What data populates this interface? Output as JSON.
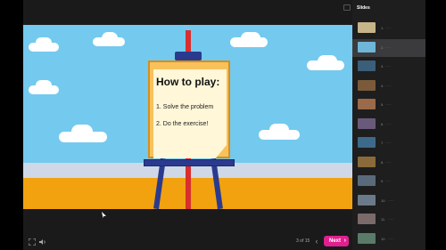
{
  "slide": {
    "title": "How to play:",
    "steps": [
      "1.  Solve the problem",
      "2.  Do the exercise!"
    ]
  },
  "controls": {
    "page_indicator": "3 of 15",
    "prev_label": "‹",
    "next_label": "Next",
    "next_chevron": "›"
  },
  "sidebar": {
    "header": "Slides",
    "active_index": 1,
    "items": [
      {
        "num": "1.",
        "text": "·····"
      },
      {
        "num": "2.",
        "text": "·····"
      },
      {
        "num": "3.",
        "text": "·····"
      },
      {
        "num": "4.",
        "text": "·····"
      },
      {
        "num": "5.",
        "text": "·····"
      },
      {
        "num": "6.",
        "text": "·····"
      },
      {
        "num": "7.",
        "text": "·····"
      },
      {
        "num": "8.",
        "text": "·····"
      },
      {
        "num": "9.",
        "text": "·····"
      },
      {
        "num": "10.",
        "text": "·····"
      },
      {
        "num": "11.",
        "text": "·····"
      },
      {
        "num": "12.",
        "text": "·····"
      }
    ]
  },
  "colors": {
    "accent": "#e0208f",
    "sky": "#74c9ee",
    "floor": "#f2a20f",
    "easel_blue": "#2a3b8f",
    "easel_red": "#d92e2e",
    "board": "#f8c15b"
  }
}
